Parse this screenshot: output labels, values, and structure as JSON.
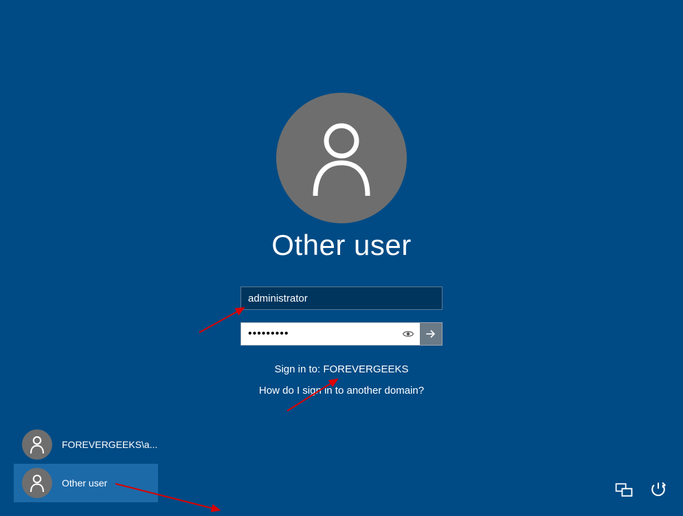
{
  "title": "Other user",
  "username_input": {
    "value": "administrator"
  },
  "password_input": {
    "value": "•••••••••"
  },
  "signin_to_label": "Sign in to: ",
  "signin_to_domain": "FOREVERGEEKS",
  "help_link": "How do I sign in to another domain?",
  "user_list": [
    {
      "label": "FOREVERGEEKS\\a...",
      "selected": false
    },
    {
      "label": "Other user",
      "selected": true
    }
  ]
}
